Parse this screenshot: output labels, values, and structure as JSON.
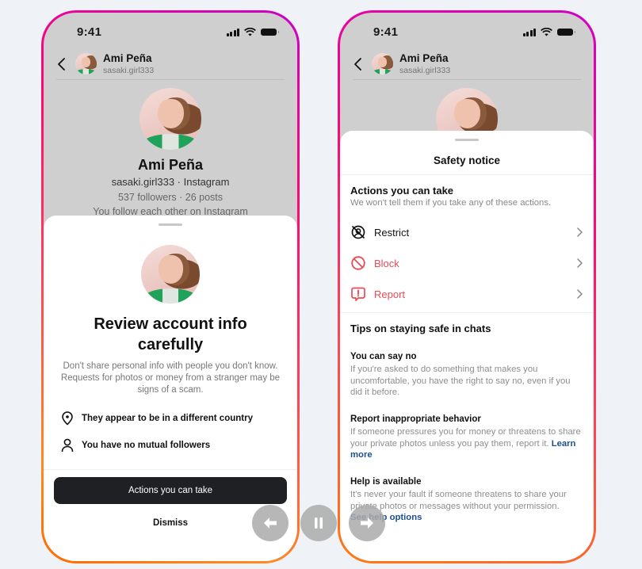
{
  "status_bar": {
    "time": "9:41"
  },
  "chat_header": {
    "name": "Ami Peña",
    "username": "sasaki.girl333"
  },
  "profile": {
    "name": "Ami Peña",
    "handle_line": "sasaki.girl333 · Instagram",
    "stats_line": "537 followers · 26 posts",
    "relationship_line": "You follow each other on Instagram"
  },
  "review_sheet": {
    "title": "Review account info carefully",
    "description": "Don't share personal info with people you don't know. Requests for photos or money from a stranger may be signs of a scam.",
    "info_items": [
      {
        "icon": "location-pin-icon",
        "text": "They appear to be in a different country"
      },
      {
        "icon": "person-icon",
        "text": "You have no mutual followers"
      }
    ],
    "primary_button": "Actions you can take",
    "secondary_button": "Dismiss"
  },
  "safety_sheet": {
    "title": "Safety notice",
    "actions_heading": "Actions you can take",
    "actions_subtext": "We won't tell them if you take any of these actions.",
    "actions": [
      {
        "icon": "restrict-icon",
        "label": "Restrict",
        "color": "#111111"
      },
      {
        "icon": "block-icon",
        "label": "Block",
        "color": "#ed4956"
      },
      {
        "icon": "report-icon",
        "label": "Report",
        "color": "#ed4956"
      }
    ],
    "tips_heading": "Tips on staying safe in chats",
    "tips": [
      {
        "title": "You can say no",
        "body": "If you're asked to do something that makes you uncomfortable, you have the right to say no, even if you did it before.",
        "link": ""
      },
      {
        "title": "Report inappropriate behavior",
        "body": "If someone pressures you for money or threatens to share your private photos unless you pay them, report it.",
        "link": "Learn more"
      },
      {
        "title": "Help is available",
        "body": "It's never your fault if someone threatens to share your private photos or messages without your permission.",
        "link": "See help options"
      }
    ]
  },
  "media_controls": {
    "previous": "arrow-left-icon",
    "pause": "pause-icon",
    "next": "arrow-right-icon"
  },
  "colors": {
    "background": "#eff3f7",
    "danger": "#ed4956",
    "link": "#1d4f8c",
    "primary_button": "#1f2024",
    "border_gradient": [
      "#d300c5",
      "#ff0069",
      "#ff7a00"
    ]
  }
}
